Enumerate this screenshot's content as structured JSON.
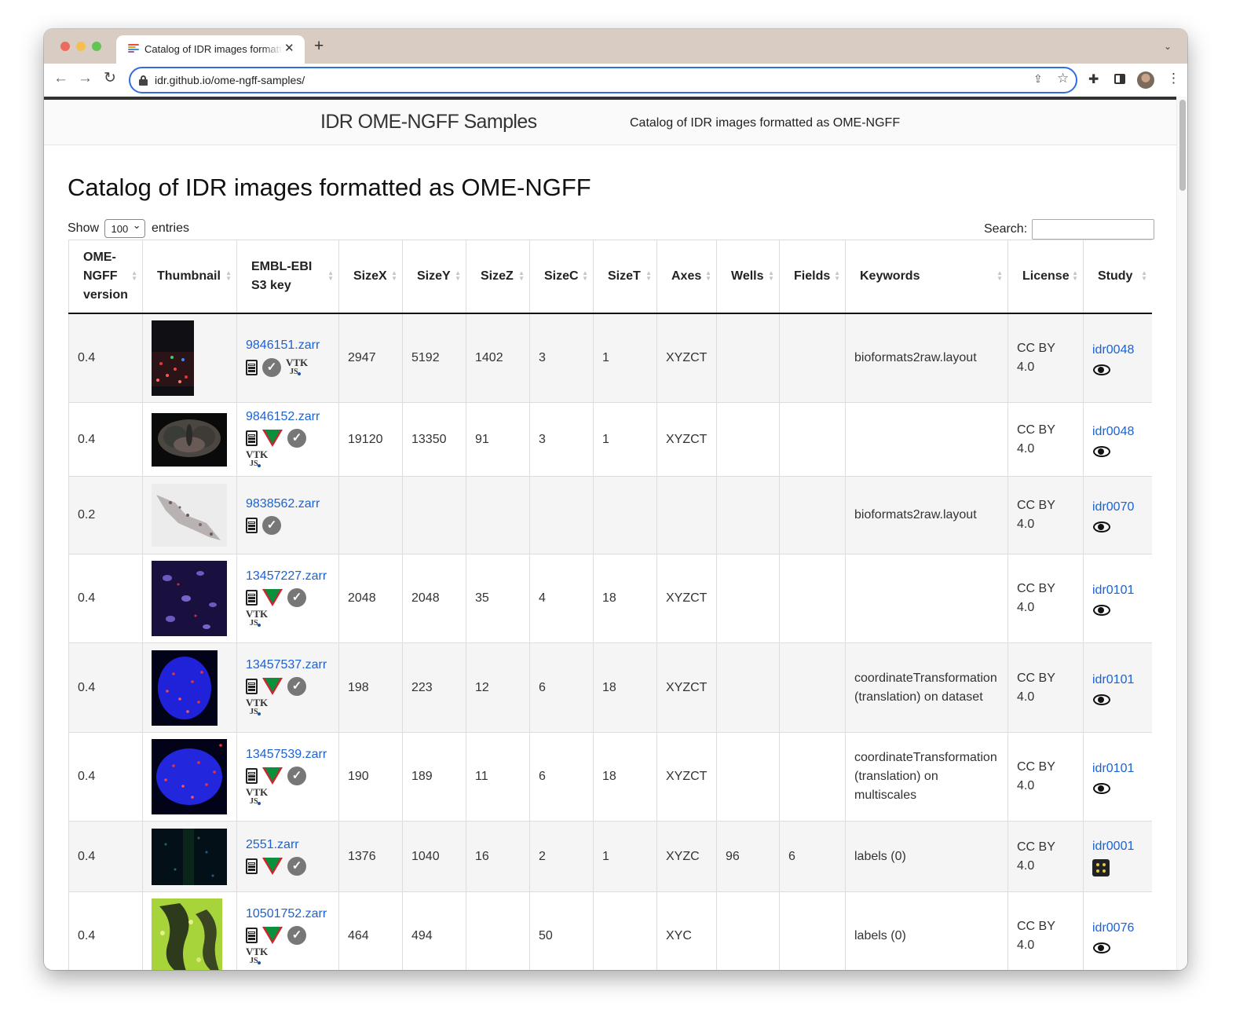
{
  "browser": {
    "tab_title": "Catalog of IDR images formatted as OME-NGFF",
    "url": "idr.github.io/ome-ngff-samples/"
  },
  "site": {
    "title": "IDR OME-NGFF Samples",
    "tagline": "Catalog of IDR images formatted as OME-NGFF"
  },
  "page": {
    "heading": "Catalog of IDR images formatted as OME-NGFF",
    "show_label": "Show",
    "entries_value": "100",
    "entries_label": "entries",
    "search_label": "Search:"
  },
  "table": {
    "headers": {
      "version": "OME-NGFF version",
      "thumbnail": "Thumbnail",
      "key": "EMBL-EBI S3 key",
      "sizex": "SizeX",
      "sizey": "SizeY",
      "sizez": "SizeZ",
      "sizec": "SizeC",
      "sizet": "SizeT",
      "axes": "Axes",
      "wells": "Wells",
      "fields": "Fields",
      "keywords": "Keywords",
      "license": "License",
      "study": "Study"
    },
    "rows": [
      {
        "version": "0.4",
        "key": "9846151.zarr",
        "sizex": "2947",
        "sizey": "5192",
        "sizez": "1402",
        "sizec": "3",
        "sizet": "1",
        "axes": "XYZCT",
        "wells": "",
        "fields": "",
        "keywords": "bioformats2raw.layout",
        "license": "CC BY 4.0",
        "study": "idr0048"
      },
      {
        "version": "0.4",
        "key": "9846152.zarr",
        "sizex": "19120",
        "sizey": "13350",
        "sizez": "91",
        "sizec": "3",
        "sizet": "1",
        "axes": "XYZCT",
        "wells": "",
        "fields": "",
        "keywords": "",
        "license": "CC BY 4.0",
        "study": "idr0048"
      },
      {
        "version": "0.2",
        "key": "9838562.zarr",
        "sizex": "",
        "sizey": "",
        "sizez": "",
        "sizec": "",
        "sizet": "",
        "axes": "",
        "wells": "",
        "fields": "",
        "keywords": "bioformats2raw.layout",
        "license": "CC BY 4.0",
        "study": "idr0070"
      },
      {
        "version": "0.4",
        "key": "13457227.zarr",
        "sizex": "2048",
        "sizey": "2048",
        "sizez": "35",
        "sizec": "4",
        "sizet": "18",
        "axes": "XYZCT",
        "wells": "",
        "fields": "",
        "keywords": "",
        "license": "CC BY 4.0",
        "study": "idr0101"
      },
      {
        "version": "0.4",
        "key": "13457537.zarr",
        "sizex": "198",
        "sizey": "223",
        "sizez": "12",
        "sizec": "6",
        "sizet": "18",
        "axes": "XYZCT",
        "wells": "",
        "fields": "",
        "keywords": "coordinateTransformation (translation) on dataset",
        "license": "CC BY 4.0",
        "study": "idr0101"
      },
      {
        "version": "0.4",
        "key": "13457539.zarr",
        "sizex": "190",
        "sizey": "189",
        "sizez": "11",
        "sizec": "6",
        "sizet": "18",
        "axes": "XYZCT",
        "wells": "",
        "fields": "",
        "keywords": "coordinateTransformation (translation) on multiscales",
        "license": "CC BY 4.0",
        "study": "idr0101"
      },
      {
        "version": "0.4",
        "key": "2551.zarr",
        "sizex": "1376",
        "sizey": "1040",
        "sizez": "16",
        "sizec": "2",
        "sizet": "1",
        "axes": "XYZC",
        "wells": "96",
        "fields": "6",
        "keywords": "labels (0)",
        "license": "CC BY 4.0",
        "study": "idr0001"
      },
      {
        "version": "0.4",
        "key": "10501752.zarr",
        "sizex": "464",
        "sizey": "494",
        "sizez": "",
        "sizec": "50",
        "sizet": "",
        "axes": "XYC",
        "wells": "",
        "fields": "",
        "keywords": "labels (0)",
        "license": "CC BY 4.0",
        "study": "idr0076"
      }
    ]
  },
  "icons": {
    "favicon": "idr-favicon",
    "copy": "clipboard-icon",
    "validator": "check-circle-icon",
    "vizarr": "vizarr-icon",
    "vtk": "vtk-js-icon",
    "viewer": "eye-icon",
    "plate": "plate-icon"
  },
  "colors": {
    "link": "#1a62d6",
    "focus_ring": "#2f6de1",
    "tab_strip": "#d8ccc3"
  }
}
